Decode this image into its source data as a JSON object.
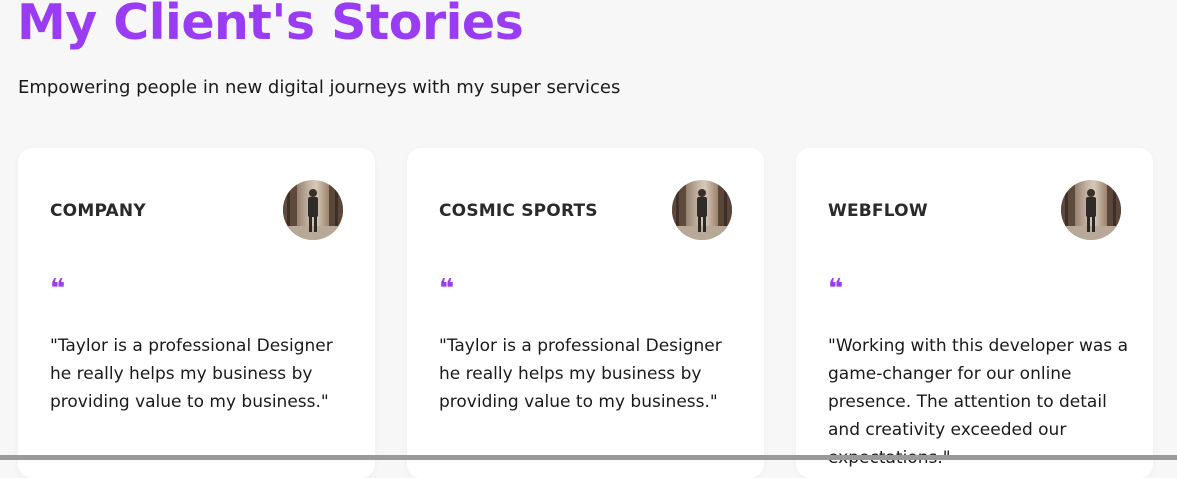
{
  "header": {
    "title": "My Client's Stories",
    "subtitle": "Empowering people in new digital journeys with my super services"
  },
  "cards": [
    {
      "company": "COMPANY",
      "avatar_icon": "client-avatar",
      "quote_icon": "quote-icon",
      "quote_mark": "❝",
      "testimonial": "\"Taylor is a professional Designer he really helps my business by providing value to my business.\""
    },
    {
      "company": "COSMIC SPORTS",
      "avatar_icon": "client-avatar",
      "quote_icon": "quote-icon",
      "quote_mark": "❝",
      "testimonial": "\"Taylor is a professional Designer he really helps my business by providing value to my business.\""
    },
    {
      "company": "WEBFLOW",
      "avatar_icon": "client-avatar",
      "quote_icon": "quote-icon",
      "quote_mark": "❝",
      "testimonial": "\"Working with this developer was a game-changer for our online presence. The attention to detail and creativity exceeded our expectations.\""
    }
  ],
  "colors": {
    "accent": "#9b3cf5",
    "background": "#f7f7f7",
    "card": "#ffffff",
    "text": "#1a1a1a"
  }
}
